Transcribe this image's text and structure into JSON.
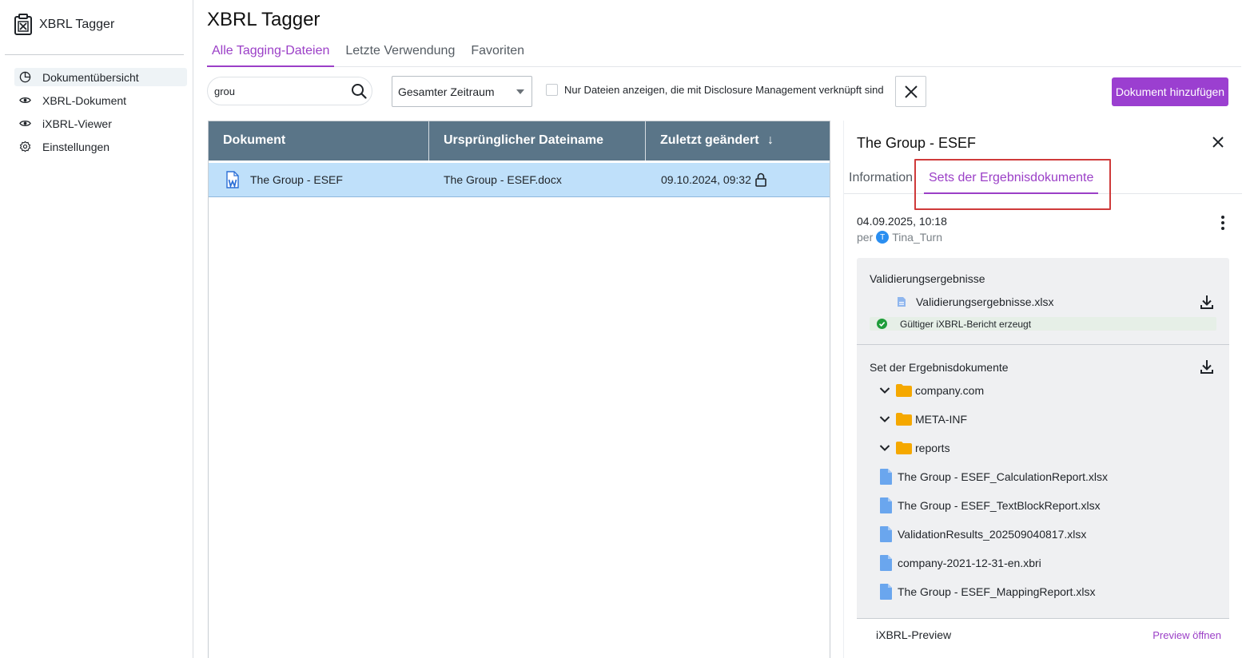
{
  "app": {
    "name": "XBRL Tagger"
  },
  "sidebar": {
    "items": [
      {
        "label": "Dokumentübersicht",
        "icon": "pie-chart-icon",
        "active": true
      },
      {
        "label": "XBRL-Dokument",
        "icon": "eye-icon"
      },
      {
        "label": "iXBRL-Viewer",
        "icon": "eye-icon"
      },
      {
        "label": "Einstellungen",
        "icon": "gear-icon"
      }
    ]
  },
  "main": {
    "title": "XBRL Tagger",
    "tabs": [
      {
        "label": "Alle Tagging-Dateien",
        "active": true
      },
      {
        "label": "Letzte Verwendung"
      },
      {
        "label": "Favoriten"
      }
    ],
    "search": {
      "value": "grou",
      "placeholder": ""
    },
    "time_filter": {
      "value": "Gesamter Zeitraum"
    },
    "checkbox_label": "Nur Dateien anzeigen, die mit Disclosure Management verknüpft sind",
    "add_button_label": "Dokument hinzufügen"
  },
  "table": {
    "columns": [
      "Dokument",
      "Ursprünglicher Dateiname",
      "Zuletzt geändert"
    ],
    "sort_indicator": "↓",
    "rows": [
      {
        "document": "The Group - ESEF",
        "filename": "The Group - ESEF.docx",
        "modified": "09.10.2024, 09:32",
        "locked": true
      }
    ]
  },
  "panel": {
    "title": "The Group - ESEF",
    "tabs": [
      {
        "label": "Information"
      },
      {
        "label": "Sets der Ergebnisdokumente",
        "active": true
      }
    ],
    "date": "04.09.2025, 10:18",
    "by_prefix": "per",
    "avatar_initial": "T",
    "user": "Tina_Turn",
    "validation": {
      "title": "Validierungsergebnisse",
      "file": "Validierungsergebnisse.xlsx",
      "status": "Gültiger iXBRL-Bericht erzeugt"
    },
    "result_set": {
      "title": "Set der Ergebnisdokumente",
      "folders": [
        "company.com",
        "META-INF",
        "reports"
      ],
      "files": [
        "The Group - ESEF_CalculationReport.xlsx",
        "The Group - ESEF_TextBlockReport.xlsx",
        "ValidationResults_202509040817.xlsx",
        "company-2021-12-31-en.xbri",
        "The Group - ESEF_MappingReport.xlsx"
      ]
    },
    "preview": {
      "label": "iXBRL-Preview",
      "link": "Preview öffnen"
    }
  },
  "colors": {
    "accent": "#9b3fc7",
    "table_header": "#5a7588",
    "selected_row": "#bfe0fa",
    "folder": "#f5a800",
    "file": "#6aa6ee"
  }
}
